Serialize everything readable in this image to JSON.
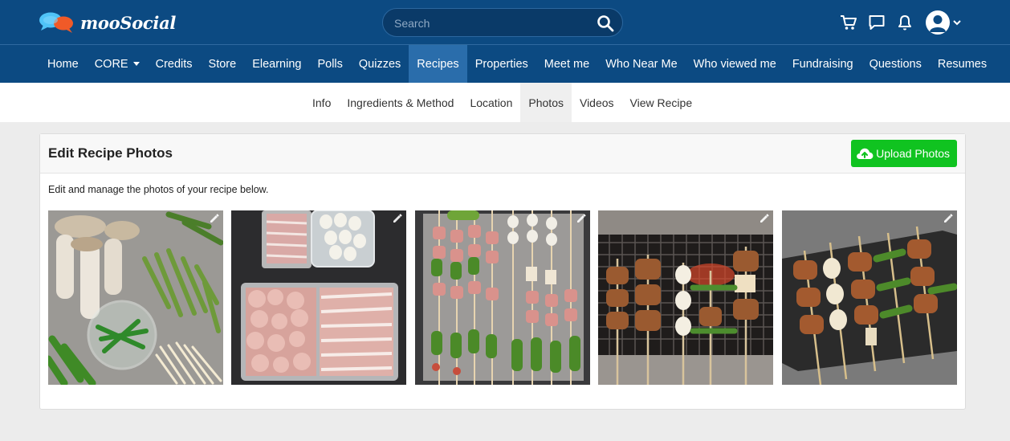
{
  "app": {
    "logo_text": "mooSocial",
    "colors": {
      "header": "#0c4a82",
      "active_nav": "#2a6dab",
      "upload_button": "#10c320"
    }
  },
  "header": {
    "search_placeholder": "Search",
    "icons": [
      "cart-icon",
      "chat-icon",
      "bell-icon",
      "avatar",
      "chevron-down-icon"
    ]
  },
  "nav": {
    "items": [
      {
        "label": "Home"
      },
      {
        "label": "CORE",
        "has_dropdown": true
      },
      {
        "label": "Credits"
      },
      {
        "label": "Store"
      },
      {
        "label": "Elearning"
      },
      {
        "label": "Polls"
      },
      {
        "label": "Quizzes"
      },
      {
        "label": "Recipes",
        "active": true
      },
      {
        "label": "Properties"
      },
      {
        "label": "Meet me"
      },
      {
        "label": "Who Near Me"
      },
      {
        "label": "Who viewed me"
      },
      {
        "label": "Fundraising"
      },
      {
        "label": "Questions"
      },
      {
        "label": "Resumes"
      }
    ]
  },
  "tabs": {
    "items": [
      {
        "label": "Info"
      },
      {
        "label": "Ingredients & Method"
      },
      {
        "label": "Location"
      },
      {
        "label": "Photos",
        "active": true
      },
      {
        "label": "Videos"
      },
      {
        "label": "View Recipe"
      }
    ]
  },
  "page": {
    "title": "Edit Recipe Photos",
    "upload_label": "Upload Photos",
    "description": "Edit and manage the photos of your recipe below."
  },
  "photos": [
    {
      "subject": "mushrooms-asparagus-okra-peppers"
    },
    {
      "subject": "raw-meat-trays-quail-eggs"
    },
    {
      "subject": "assembled-skewers-tray"
    },
    {
      "subject": "skewers-on-grill"
    },
    {
      "subject": "grilled-skewers-on-slate"
    }
  ]
}
